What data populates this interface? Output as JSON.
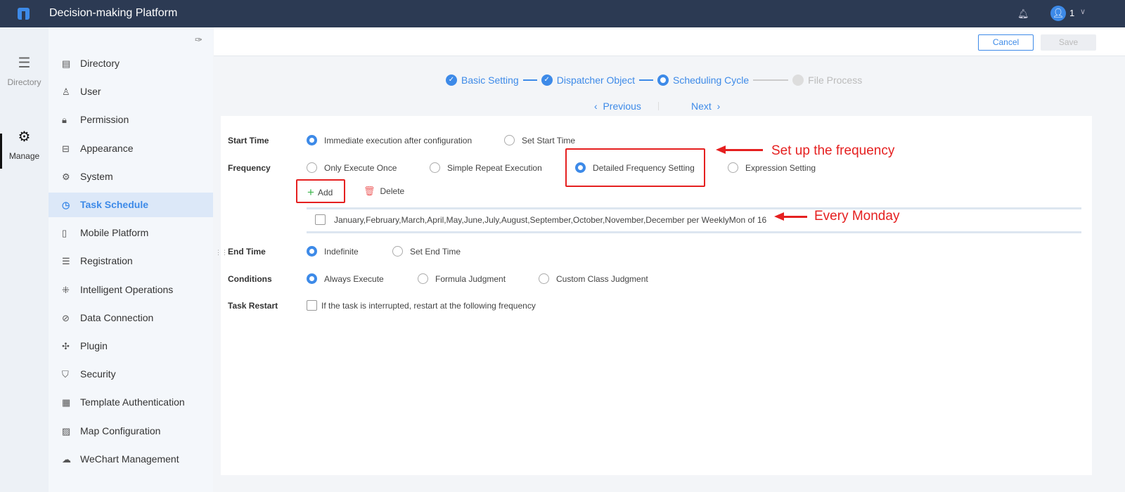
{
  "header": {
    "title": "Decision-making Platform",
    "user": "1"
  },
  "rail": [
    {
      "label": "Directory"
    },
    {
      "label": "Manage"
    }
  ],
  "sidebar": {
    "items": [
      {
        "label": "Directory",
        "icon": "directory-icon",
        "glyph": "▤"
      },
      {
        "label": "User",
        "icon": "user-icon",
        "glyph": "♙"
      },
      {
        "label": "Permission",
        "icon": "lock-icon",
        "glyph": "🔒︎"
      },
      {
        "label": "Appearance",
        "icon": "paint-roller-icon",
        "glyph": "⊟"
      },
      {
        "label": "System",
        "icon": "gear-icon",
        "glyph": "⚙"
      },
      {
        "label": "Task Schedule",
        "icon": "clock-icon",
        "glyph": "◷"
      },
      {
        "label": "Mobile Platform",
        "icon": "mobile-icon",
        "glyph": "▯"
      },
      {
        "label": "Registration",
        "icon": "registration-icon",
        "glyph": "☰"
      },
      {
        "label": "Intelligent Operations",
        "icon": "nodes-icon",
        "glyph": "⁜"
      },
      {
        "label": "Data Connection",
        "icon": "link-icon",
        "glyph": "⊘"
      },
      {
        "label": "Plugin",
        "icon": "puzzle-icon",
        "glyph": "✣"
      },
      {
        "label": "Security",
        "icon": "shield-icon",
        "glyph": "⛉"
      },
      {
        "label": "Template Authentication",
        "icon": "template-icon",
        "glyph": "▦"
      },
      {
        "label": "Map Configuration",
        "icon": "map-icon",
        "glyph": "▨"
      },
      {
        "label": "WeChart Management",
        "icon": "wechat-icon",
        "glyph": "☁"
      }
    ]
  },
  "toolbar": {
    "cancel": "Cancel",
    "save": "Save"
  },
  "steps": [
    "Basic Setting",
    "Dispatcher Object",
    "Scheduling Cycle",
    "File Process"
  ],
  "nav": {
    "previous": "Previous",
    "next": "Next"
  },
  "form": {
    "start_time": {
      "label": "Start Time",
      "options": [
        "Immediate execution after configuration",
        "Set Start Time"
      ]
    },
    "frequency": {
      "label": "Frequency",
      "options": [
        "Only Execute Once",
        "Simple Repeat Execution",
        "Detailed Frequency Setting",
        "Expression Setting"
      ]
    },
    "add": "Add",
    "delete": "Delete",
    "row": "January,February,March,April,May,June,July,August,September,October,November,December per WeeklyMon of 16",
    "end_time": {
      "label": "End Time",
      "options": [
        "Indefinite",
        "Set End Time"
      ]
    },
    "conditions": {
      "label": "Conditions",
      "options": [
        "Always Execute",
        "Formula Judgment",
        "Custom Class Judgment"
      ]
    },
    "task_restart": {
      "label": "Task Restart",
      "option": "If the task is interrupted, restart at the following frequency"
    }
  },
  "annotations": {
    "frequency": "Set up the frequency",
    "monday": "Every Monday"
  },
  "colors": {
    "accent": "#3d8ae8",
    "header": "#2c3a53",
    "annotation": "#e52020"
  }
}
